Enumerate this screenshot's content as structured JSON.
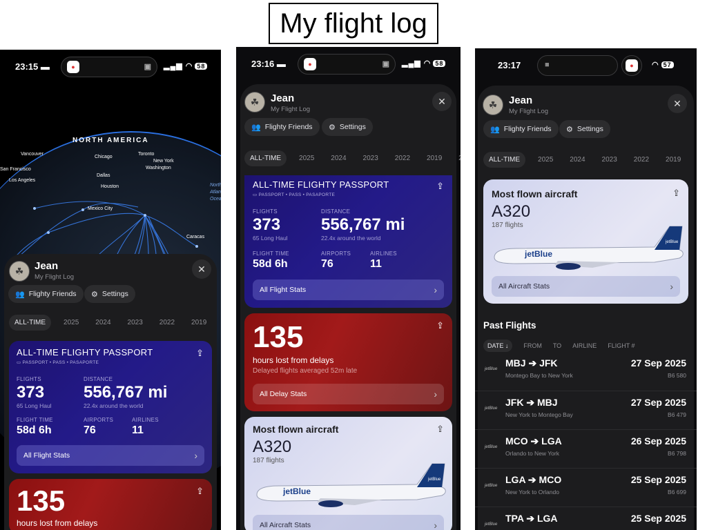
{
  "page_title": "My flight log",
  "screens": [
    {
      "time": "23:15",
      "battery": "58",
      "globe": {
        "continent": "NORTH AMERICA",
        "ocean": "North Atlantic Ocean",
        "cities": [
          "Vancouver",
          "Chicago",
          "Toronto",
          "New York",
          "Washington",
          "San Francisco",
          "Los Angeles",
          "Dallas",
          "Houston",
          "Mexico City",
          "Caracas"
        ]
      }
    },
    {
      "time": "23:16",
      "battery": "58"
    },
    {
      "time": "23:17",
      "battery": "57"
    }
  ],
  "profile": {
    "name": "Jean",
    "subtitle": "My Flight Log",
    "friends_label": "Flighty Friends",
    "settings_label": "Settings"
  },
  "year_tabs": [
    "ALL-TIME",
    "2025",
    "2024",
    "2023",
    "2022",
    "2019",
    "20"
  ],
  "passport": {
    "title": "ALL-TIME FLIGHTY PASSPORT",
    "subtitle": "PASSPORT • PASS • PASAPORTE",
    "flights_label": "FLIGHTS",
    "flights_value": "373",
    "flights_sub": "65 Long Haul",
    "distance_label": "DISTANCE",
    "distance_value": "556,767 mi",
    "distance_sub": "22.4x around the world",
    "time_label": "FLIGHT TIME",
    "time_value": "58d 6h",
    "airports_label": "AIRPORTS",
    "airports_value": "76",
    "airlines_label": "AIRLINES",
    "airlines_value": "11",
    "link": "All Flight Stats"
  },
  "delays": {
    "value": "135",
    "label": "hours lost from delays",
    "sub": "Delayed flights averaged 52m late",
    "link": "All Delay Stats"
  },
  "aircraft": {
    "heading": "Most flown aircraft",
    "model": "A320",
    "count": "187 flights",
    "livery": "jetBlue",
    "link": "All Aircraft Stats"
  },
  "past_flights": {
    "title": "Past Flights",
    "filters": [
      "DATE ↓",
      "FROM",
      "TO",
      "AIRLINE",
      "FLIGHT #"
    ],
    "rows": [
      {
        "logo": "jetBlue",
        "route": "MBJ ➔ JFK",
        "desc": "Montego Bay to New York",
        "date": "27 Sep 2025",
        "num": "B6 580"
      },
      {
        "logo": "jetBlue",
        "route": "JFK ➔ MBJ",
        "desc": "New York to Montego Bay",
        "date": "27 Sep 2025",
        "num": "B6 479"
      },
      {
        "logo": "jetBlue",
        "route": "MCO ➔ LGA",
        "desc": "Orlando to New York",
        "date": "26 Sep 2025",
        "num": "B6 798"
      },
      {
        "logo": "jetBlue",
        "route": "LGA ➔ MCO",
        "desc": "New York to Orlando",
        "date": "25 Sep 2025",
        "num": "B6 699"
      },
      {
        "logo": "jetBlue",
        "route": "TPA ➔ LGA",
        "desc": "",
        "date": "25 Sep 2025",
        "num": ""
      }
    ]
  },
  "colors": {
    "passport_bg": "#231a88",
    "delay_bg": "#a21a1a",
    "aircraft_bg": "#dfe1f2",
    "route_line": "#2a6fe0"
  }
}
